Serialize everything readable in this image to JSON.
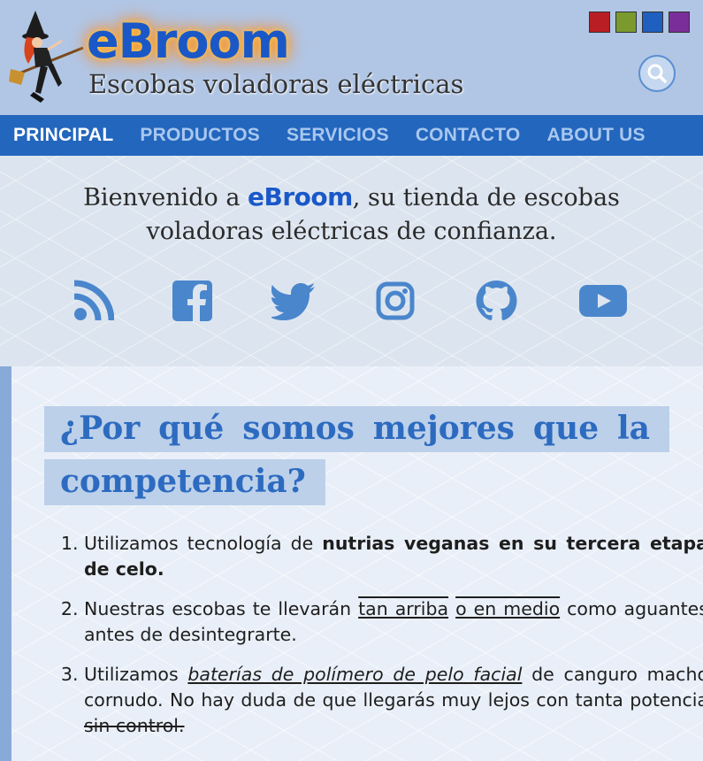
{
  "header": {
    "logo": "eBroom",
    "tagline": "Escobas voladoras eléctricas",
    "theme_swatches": [
      "#b81e24",
      "#7a9a2e",
      "#1f5fbf",
      "#7a2e9a"
    ]
  },
  "nav": {
    "items": [
      "PRINCIPAL",
      "PRODUCTOS",
      "SERVICIOS",
      "CONTACTO",
      "ABOUT US"
    ]
  },
  "hero": {
    "welcome_pre": "Bienvenido a ",
    "welcome_brand": "eBroom",
    "welcome_post": ", su tienda de escobas voladoras eléctricas de confianza.",
    "social_icons": [
      "rss-icon",
      "facebook-icon",
      "twitter-icon",
      "instagram-icon",
      "github-icon",
      "youtube-icon"
    ]
  },
  "content": {
    "heading": "¿Por qué somos mejores que la competencia?",
    "items": [
      {
        "t1": "Utilizamos tecnología de ",
        "bold": "nutrias veganas en su tercera etapa de celo."
      },
      {
        "t1": "Nuestras escobas te llevarán ",
        "u1": "tan arriba",
        "t2": " ",
        "u2": "o en medio",
        "t3": " como aguantes antes de desintegrarte."
      },
      {
        "t1": "Utilizamos ",
        "iu": "baterías de polímero de pelo facial",
        "t2": " de canguro macho cornudo. No hay duda de que llegarás muy lejos con tanta potencia ",
        "strike": "sin control."
      }
    ]
  }
}
